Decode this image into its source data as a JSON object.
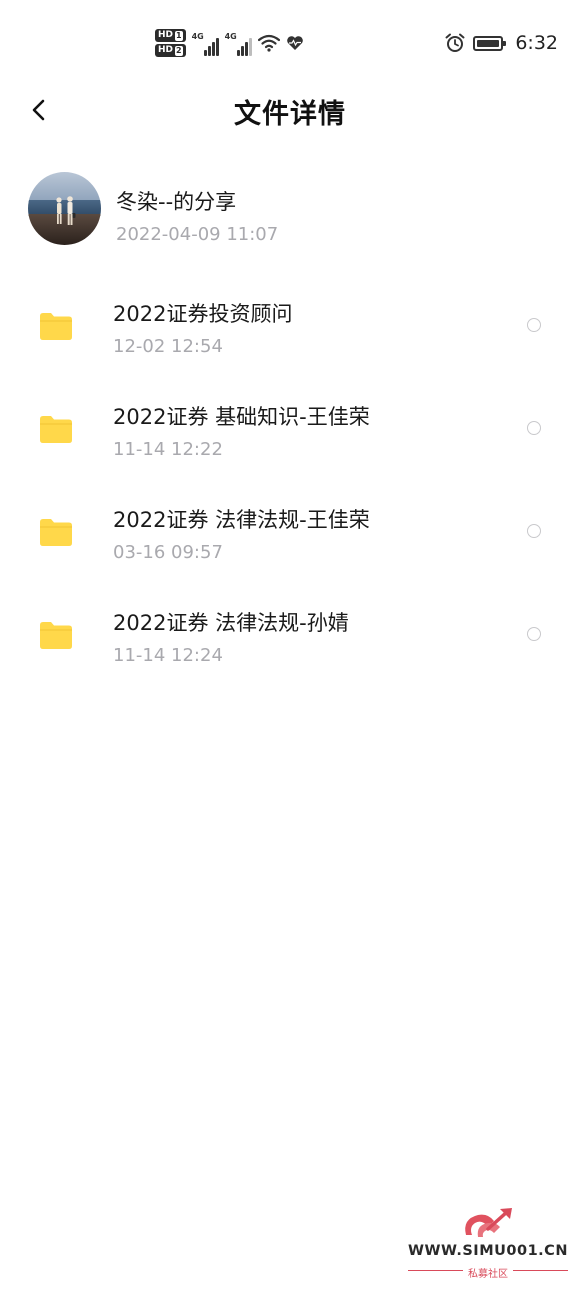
{
  "status_bar": {
    "sim1_label": "HD",
    "sim1_num": "1",
    "sim2_label": "HD",
    "sim2_num": "2",
    "network1": "4G",
    "network2": "4G",
    "time": "6:32"
  },
  "header": {
    "title": "文件详情"
  },
  "sharer": {
    "name": "冬染--的分享",
    "time": "2022-04-09  11:07"
  },
  "files": [
    {
      "name": "2022证券投资顾问",
      "time": "12-02  12:54"
    },
    {
      "name": "2022证券 基础知识-王佳荣",
      "time": "11-14  12:22"
    },
    {
      "name": "2022证券 法律法规-王佳荣",
      "time": "03-16  09:57"
    },
    {
      "name": "2022证券 法律法规-孙婧",
      "time": "11-14  12:24"
    }
  ],
  "watermark": {
    "site": "WWW.SIMU001.CN",
    "label": "私募社区"
  },
  "colors": {
    "folder": "#FFD84A",
    "secondary_text": "#A9A9AE",
    "watermark_accent": "#D94A5A"
  },
  "icons": {
    "back": "chevron-left-icon",
    "folder": "folder-icon",
    "wifi": "wifi-icon",
    "heart": "heart-pulse-icon",
    "alarm": "alarm-icon",
    "battery": "battery-icon"
  }
}
